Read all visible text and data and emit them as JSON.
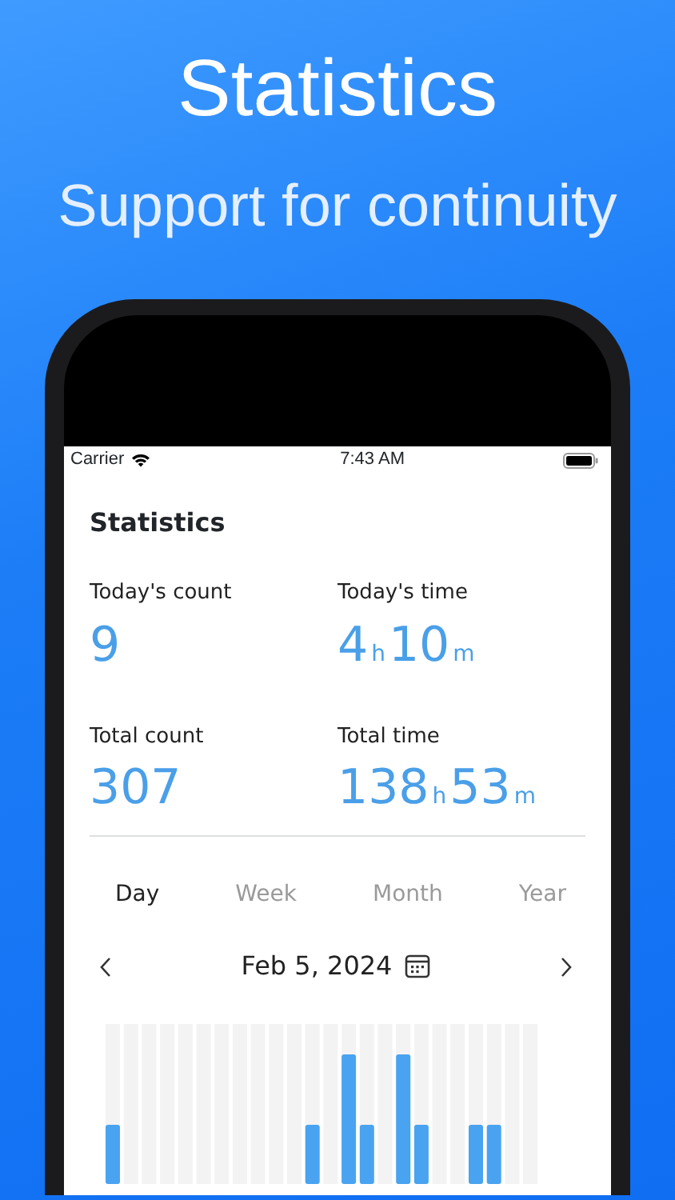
{
  "header": {
    "title": "Statistics",
    "subtitle": "Support for continuity"
  },
  "status_bar": {
    "carrier": "Carrier",
    "time": "7:43 AM"
  },
  "screen_title": "Statistics",
  "stats": [
    {
      "label": "Today's count",
      "parts": [
        {
          "number": "9"
        }
      ]
    },
    {
      "label": "Today's time",
      "parts": [
        {
          "number": "4",
          "unit": "h"
        },
        {
          "number": "10",
          "unit": "m"
        }
      ]
    },
    {
      "label": "Total count",
      "parts": [
        {
          "number": "307"
        }
      ]
    },
    {
      "label": "Total time",
      "parts": [
        {
          "number": "138",
          "unit": "h"
        },
        {
          "number": "53",
          "unit": "m"
        }
      ]
    }
  ],
  "periods": [
    {
      "label": "Day",
      "selected": true
    },
    {
      "label": "Week",
      "selected": false
    },
    {
      "label": "Month",
      "selected": false
    },
    {
      "label": "Year",
      "selected": false
    }
  ],
  "date_nav": {
    "date": "Feb 5, 2024"
  }
}
